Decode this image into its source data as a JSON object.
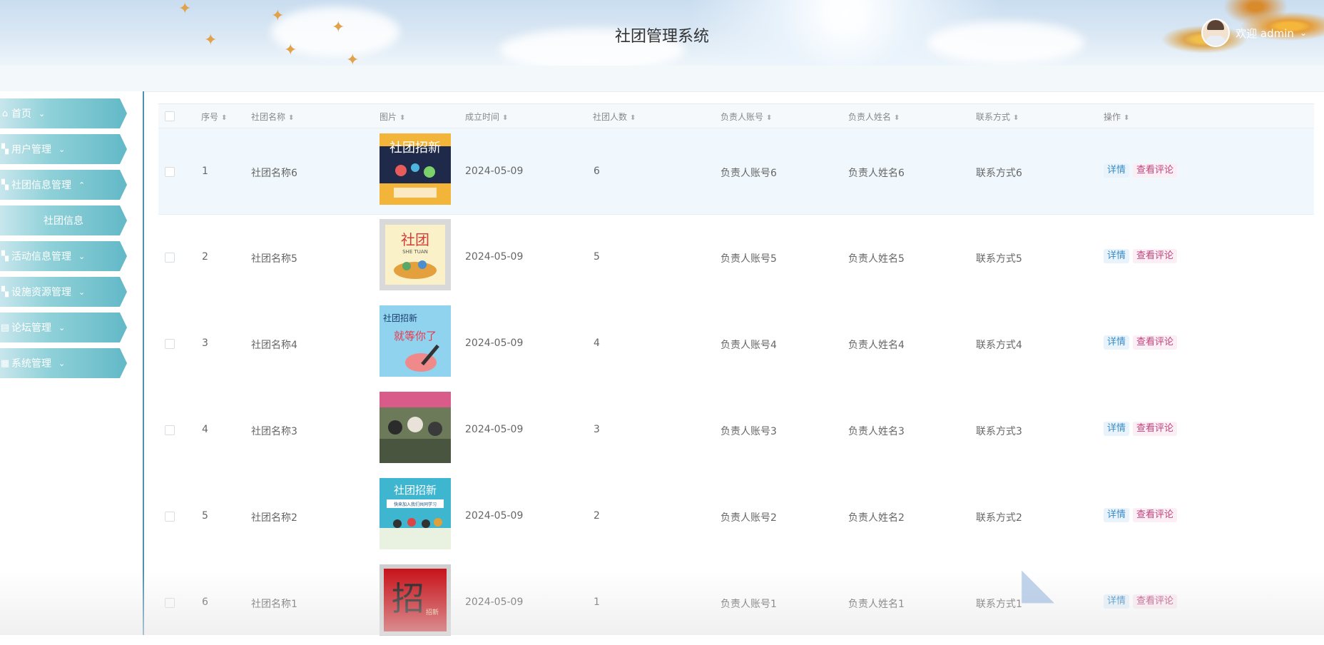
{
  "header": {
    "title": "社团管理系统",
    "user_greeting": "欢迎 admin"
  },
  "sidebar": {
    "items": [
      {
        "label": "首页",
        "icon": "home-icon",
        "arrow": "⌄"
      },
      {
        "label": "用户管理",
        "icon": "user-icon",
        "arrow": "⌄"
      },
      {
        "label": "社团信息管理",
        "icon": "club-icon",
        "arrow": "⌃"
      },
      {
        "label": "社团信息",
        "icon": "",
        "arrow": ""
      },
      {
        "label": "活动信息管理",
        "icon": "activity-icon",
        "arrow": "⌄"
      },
      {
        "label": "设施资源管理",
        "icon": "facility-icon",
        "arrow": "⌄"
      },
      {
        "label": "论坛管理",
        "icon": "forum-icon",
        "arrow": "⌄"
      },
      {
        "label": "系统管理",
        "icon": "system-icon",
        "arrow": "⌄"
      }
    ]
  },
  "table": {
    "columns": [
      "序号",
      "社团名称",
      "图片",
      "成立时间",
      "社团人数",
      "负责人账号",
      "负责人姓名",
      "联系方式",
      "操作"
    ],
    "rows": [
      {
        "index": "1",
        "name": "社团名称6",
        "date": "2024-05-09",
        "members": "6",
        "account": "负责人账号6",
        "person": "负责人姓名6",
        "contact": "联系方式6"
      },
      {
        "index": "2",
        "name": "社团名称5",
        "date": "2024-05-09",
        "members": "5",
        "account": "负责人账号5",
        "person": "负责人姓名5",
        "contact": "联系方式5"
      },
      {
        "index": "3",
        "name": "社团名称4",
        "date": "2024-05-09",
        "members": "4",
        "account": "负责人账号4",
        "person": "负责人姓名4",
        "contact": "联系方式4"
      },
      {
        "index": "4",
        "name": "社团名称3",
        "date": "2024-05-09",
        "members": "3",
        "account": "负责人账号3",
        "person": "负责人姓名3",
        "contact": "联系方式3"
      },
      {
        "index": "5",
        "name": "社团名称2",
        "date": "2024-05-09",
        "members": "2",
        "account": "负责人账号2",
        "person": "负责人姓名2",
        "contact": "联系方式2"
      },
      {
        "index": "6",
        "name": "社团名称1",
        "date": "2024-05-09",
        "members": "1",
        "account": "负责人账号1",
        "person": "负责人姓名1",
        "contact": "联系方式1"
      }
    ],
    "actions": {
      "detail": "详情",
      "comments": "查看评论"
    }
  },
  "posters": {
    "p1": {
      "text": "社团招新"
    },
    "p2": {
      "text": "社团",
      "sub": "SHE TUAN"
    },
    "p3": {
      "text_a": "社团招新",
      "text_b": "就等你了"
    },
    "p5": {
      "text": "社团招新",
      "sub": "快来加入我们共同学习"
    },
    "p6": {
      "text": "招",
      "sub": "招新"
    }
  }
}
